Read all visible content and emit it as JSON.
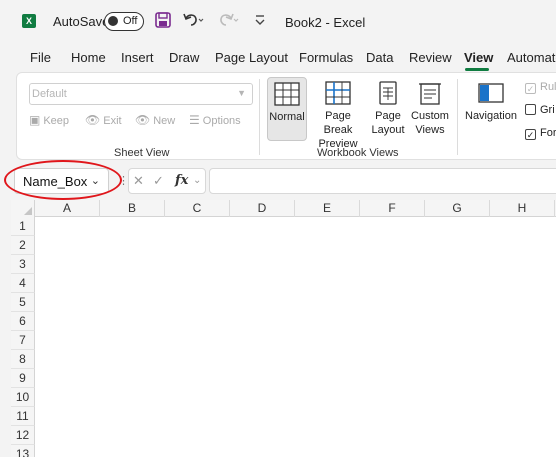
{
  "titlebar": {
    "app_badge": "X",
    "autosave_label": "AutoSave",
    "autosave_state": "Off",
    "doc_title": "Book2 - Excel"
  },
  "tabs": [
    "File",
    "Home",
    "Insert",
    "Draw",
    "Page Layout",
    "Formulas",
    "Data",
    "Review",
    "View",
    "Automate"
  ],
  "active_tab": "View",
  "ribbon": {
    "sheet_view": {
      "dropdown_value": "Default",
      "keep": "Keep",
      "exit": "Exit",
      "new": "New",
      "options": "Options",
      "label": "Sheet View"
    },
    "workbook_views": {
      "normal": "Normal",
      "page_break_line1": "Page Break",
      "page_break_line2": "Preview",
      "page_layout_line1": "Page",
      "page_layout_line2": "Layout",
      "custom_line1": "Custom",
      "custom_line2": "Views",
      "label": "Workbook Views"
    },
    "navigation": "Navigation",
    "show": {
      "ruler": "Rul",
      "gridlines": "Gri",
      "formula_bar": "For"
    }
  },
  "formula_bar": {
    "name_box": "Name_Box",
    "dots": "⋮",
    "fx": "fx"
  },
  "grid": {
    "columns": [
      "A",
      "B",
      "C",
      "D",
      "E",
      "F",
      "G",
      "H"
    ],
    "rows": [
      "1",
      "2",
      "3",
      "4",
      "5",
      "6",
      "7",
      "8",
      "9",
      "10",
      "11",
      "12",
      "13"
    ]
  },
  "colors": {
    "excel_green": "#107c41",
    "annotation_red": "#e0161b",
    "ribbon_bg": "#ffffff",
    "window_bg": "#f3f3f3"
  }
}
